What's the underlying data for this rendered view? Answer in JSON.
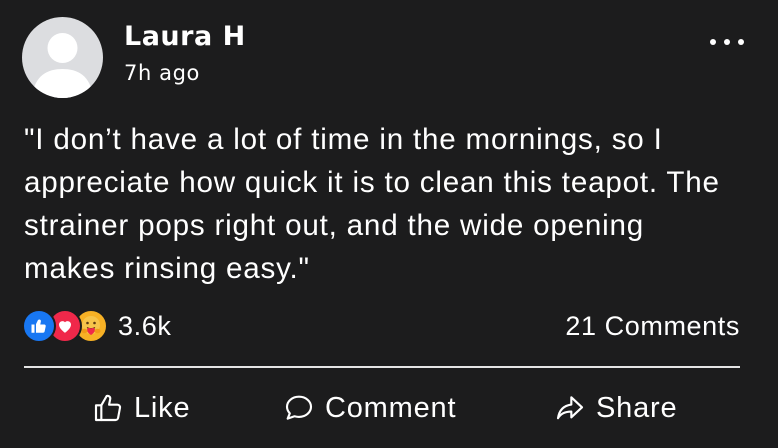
{
  "post": {
    "author": "Laura H",
    "timestamp": "7h ago",
    "body": "\"I don’t have a lot of time in the mornings, so I appreciate how quick it is to clean this teapot. The strainer pops right out, and the wide opening makes rinsing easy.\"",
    "reaction_count": "3.6k",
    "comments_count": "21 Comments",
    "reactions": [
      "like-reaction-icon",
      "love-reaction-icon",
      "care-reaction-icon"
    ]
  },
  "actions": {
    "like_label": "Like",
    "comment_label": "Comment",
    "share_label": "Share"
  },
  "colors": {
    "background": "#1c1c1d",
    "text": "#ffffff",
    "like_blue": "#1877f2",
    "love_red": "#f0284a",
    "care_yellow": "#f7b125",
    "avatar_gray": "#dcdde0"
  }
}
